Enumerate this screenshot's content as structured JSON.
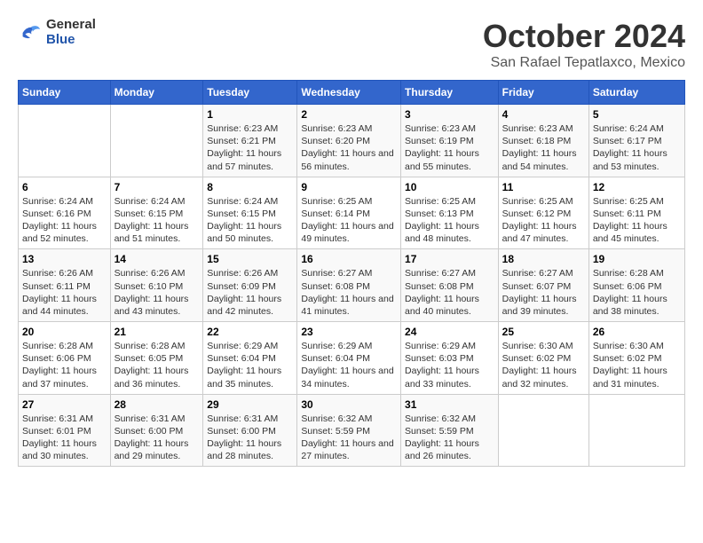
{
  "logo": {
    "general": "General",
    "blue": "Blue"
  },
  "title": "October 2024",
  "subtitle": "San Rafael Tepatlaxco, Mexico",
  "headers": [
    "Sunday",
    "Monday",
    "Tuesday",
    "Wednesday",
    "Thursday",
    "Friday",
    "Saturday"
  ],
  "weeks": [
    [
      {
        "day": "",
        "info": ""
      },
      {
        "day": "",
        "info": ""
      },
      {
        "day": "1",
        "info": "Sunrise: 6:23 AM\nSunset: 6:21 PM\nDaylight: 11 hours and 57 minutes."
      },
      {
        "day": "2",
        "info": "Sunrise: 6:23 AM\nSunset: 6:20 PM\nDaylight: 11 hours and 56 minutes."
      },
      {
        "day": "3",
        "info": "Sunrise: 6:23 AM\nSunset: 6:19 PM\nDaylight: 11 hours and 55 minutes."
      },
      {
        "day": "4",
        "info": "Sunrise: 6:23 AM\nSunset: 6:18 PM\nDaylight: 11 hours and 54 minutes."
      },
      {
        "day": "5",
        "info": "Sunrise: 6:24 AM\nSunset: 6:17 PM\nDaylight: 11 hours and 53 minutes."
      }
    ],
    [
      {
        "day": "6",
        "info": "Sunrise: 6:24 AM\nSunset: 6:16 PM\nDaylight: 11 hours and 52 minutes."
      },
      {
        "day": "7",
        "info": "Sunrise: 6:24 AM\nSunset: 6:15 PM\nDaylight: 11 hours and 51 minutes."
      },
      {
        "day": "8",
        "info": "Sunrise: 6:24 AM\nSunset: 6:15 PM\nDaylight: 11 hours and 50 minutes."
      },
      {
        "day": "9",
        "info": "Sunrise: 6:25 AM\nSunset: 6:14 PM\nDaylight: 11 hours and 49 minutes."
      },
      {
        "day": "10",
        "info": "Sunrise: 6:25 AM\nSunset: 6:13 PM\nDaylight: 11 hours and 48 minutes."
      },
      {
        "day": "11",
        "info": "Sunrise: 6:25 AM\nSunset: 6:12 PM\nDaylight: 11 hours and 47 minutes."
      },
      {
        "day": "12",
        "info": "Sunrise: 6:25 AM\nSunset: 6:11 PM\nDaylight: 11 hours and 45 minutes."
      }
    ],
    [
      {
        "day": "13",
        "info": "Sunrise: 6:26 AM\nSunset: 6:11 PM\nDaylight: 11 hours and 44 minutes."
      },
      {
        "day": "14",
        "info": "Sunrise: 6:26 AM\nSunset: 6:10 PM\nDaylight: 11 hours and 43 minutes."
      },
      {
        "day": "15",
        "info": "Sunrise: 6:26 AM\nSunset: 6:09 PM\nDaylight: 11 hours and 42 minutes."
      },
      {
        "day": "16",
        "info": "Sunrise: 6:27 AM\nSunset: 6:08 PM\nDaylight: 11 hours and 41 minutes."
      },
      {
        "day": "17",
        "info": "Sunrise: 6:27 AM\nSunset: 6:08 PM\nDaylight: 11 hours and 40 minutes."
      },
      {
        "day": "18",
        "info": "Sunrise: 6:27 AM\nSunset: 6:07 PM\nDaylight: 11 hours and 39 minutes."
      },
      {
        "day": "19",
        "info": "Sunrise: 6:28 AM\nSunset: 6:06 PM\nDaylight: 11 hours and 38 minutes."
      }
    ],
    [
      {
        "day": "20",
        "info": "Sunrise: 6:28 AM\nSunset: 6:06 PM\nDaylight: 11 hours and 37 minutes."
      },
      {
        "day": "21",
        "info": "Sunrise: 6:28 AM\nSunset: 6:05 PM\nDaylight: 11 hours and 36 minutes."
      },
      {
        "day": "22",
        "info": "Sunrise: 6:29 AM\nSunset: 6:04 PM\nDaylight: 11 hours and 35 minutes."
      },
      {
        "day": "23",
        "info": "Sunrise: 6:29 AM\nSunset: 6:04 PM\nDaylight: 11 hours and 34 minutes."
      },
      {
        "day": "24",
        "info": "Sunrise: 6:29 AM\nSunset: 6:03 PM\nDaylight: 11 hours and 33 minutes."
      },
      {
        "day": "25",
        "info": "Sunrise: 6:30 AM\nSunset: 6:02 PM\nDaylight: 11 hours and 32 minutes."
      },
      {
        "day": "26",
        "info": "Sunrise: 6:30 AM\nSunset: 6:02 PM\nDaylight: 11 hours and 31 minutes."
      }
    ],
    [
      {
        "day": "27",
        "info": "Sunrise: 6:31 AM\nSunset: 6:01 PM\nDaylight: 11 hours and 30 minutes."
      },
      {
        "day": "28",
        "info": "Sunrise: 6:31 AM\nSunset: 6:00 PM\nDaylight: 11 hours and 29 minutes."
      },
      {
        "day": "29",
        "info": "Sunrise: 6:31 AM\nSunset: 6:00 PM\nDaylight: 11 hours and 28 minutes."
      },
      {
        "day": "30",
        "info": "Sunrise: 6:32 AM\nSunset: 5:59 PM\nDaylight: 11 hours and 27 minutes."
      },
      {
        "day": "31",
        "info": "Sunrise: 6:32 AM\nSunset: 5:59 PM\nDaylight: 11 hours and 26 minutes."
      },
      {
        "day": "",
        "info": ""
      },
      {
        "day": "",
        "info": ""
      }
    ]
  ]
}
